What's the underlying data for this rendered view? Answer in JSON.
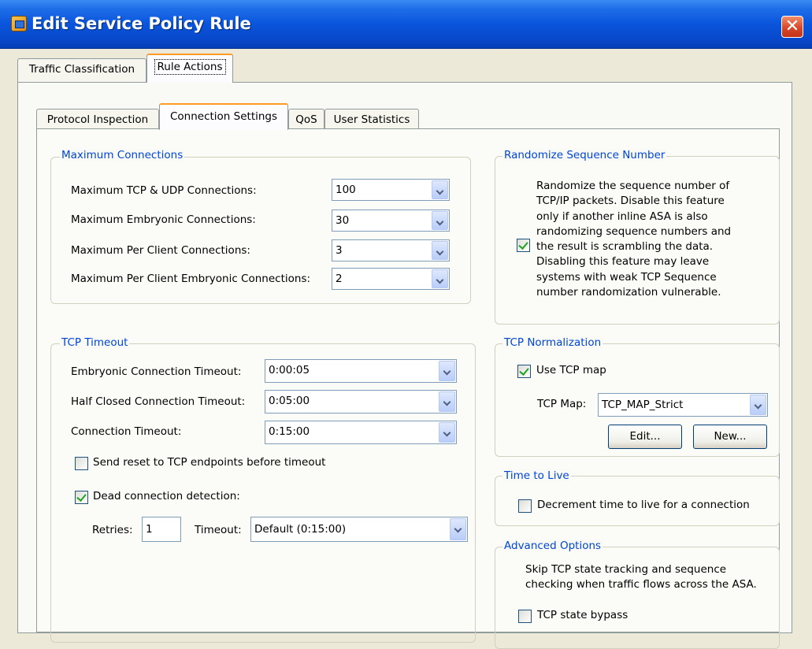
{
  "window": {
    "title": "Edit Service Policy Rule",
    "close_glyph": "✕"
  },
  "top_tabs": [
    {
      "label": "Traffic Classification",
      "active": false
    },
    {
      "label": "Rule Actions",
      "active": true
    }
  ],
  "sub_tabs": [
    {
      "label": "Protocol Inspection",
      "active": false
    },
    {
      "label": "Connection Settings",
      "active": true
    },
    {
      "label": "QoS",
      "active": false
    },
    {
      "label": "User Statistics",
      "active": false
    }
  ],
  "max_connections": {
    "legend": "Maximum Connections",
    "rows": [
      {
        "label": "Maximum TCP & UDP Connections:",
        "value": "100"
      },
      {
        "label": "Maximum Embryonic Connections:",
        "value": "30"
      },
      {
        "label": "Maximum Per Client Connections:",
        "value": "3"
      },
      {
        "label": "Maximum Per Client Embryonic Connections:",
        "value": "2"
      }
    ]
  },
  "tcp_timeout": {
    "legend": "TCP Timeout",
    "rows": [
      {
        "label": "Embryonic Connection Timeout:",
        "value": "0:00:05"
      },
      {
        "label": "Half Closed Connection Timeout:",
        "value": "0:05:00"
      },
      {
        "label": "Connection Timeout:",
        "value": "0:15:00"
      }
    ],
    "send_reset": {
      "label": "Send reset to TCP endpoints before timeout",
      "checked": false
    },
    "dead_detection": {
      "label": "Dead connection detection:",
      "checked": true
    },
    "retries_label": "Retries:",
    "retries_value": "1",
    "timeout_label": "Timeout:",
    "timeout_value": "Default (0:15:00)"
  },
  "randomize": {
    "legend": "Randomize Sequence Number",
    "checked": true,
    "lines": [
      "Randomize the sequence number of",
      "TCP/IP packets. Disable this feature",
      "only if another inline ASA is also",
      "randomizing sequence numbers and",
      "the result is scrambling the data.",
      "Disabling this feature may leave",
      "systems with weak TCP Sequence",
      "number randomization vulnerable."
    ]
  },
  "tcp_normalization": {
    "legend": "TCP Normalization",
    "use_map": {
      "label": "Use TCP map",
      "checked": true
    },
    "map_label": "TCP Map:",
    "map_value": "TCP_MAP_Strict",
    "edit_label": "Edit...",
    "new_label": "New..."
  },
  "ttl": {
    "legend": "Time to Live",
    "decrement": {
      "label": "Decrement time to live for a connection",
      "checked": false
    }
  },
  "advanced": {
    "legend": "Advanced Options",
    "lines": [
      "Skip TCP state tracking and sequence",
      "checking when traffic flows across the ASA."
    ],
    "bypass": {
      "label": "TCP state bypass",
      "checked": false
    }
  },
  "colors": {
    "titlebar": "#0a55dc",
    "legend_text": "#0046d5",
    "active_tab_accent": "#ff9a25",
    "check_mark": "#21a121",
    "dialog_bg": "#ece9d8"
  }
}
